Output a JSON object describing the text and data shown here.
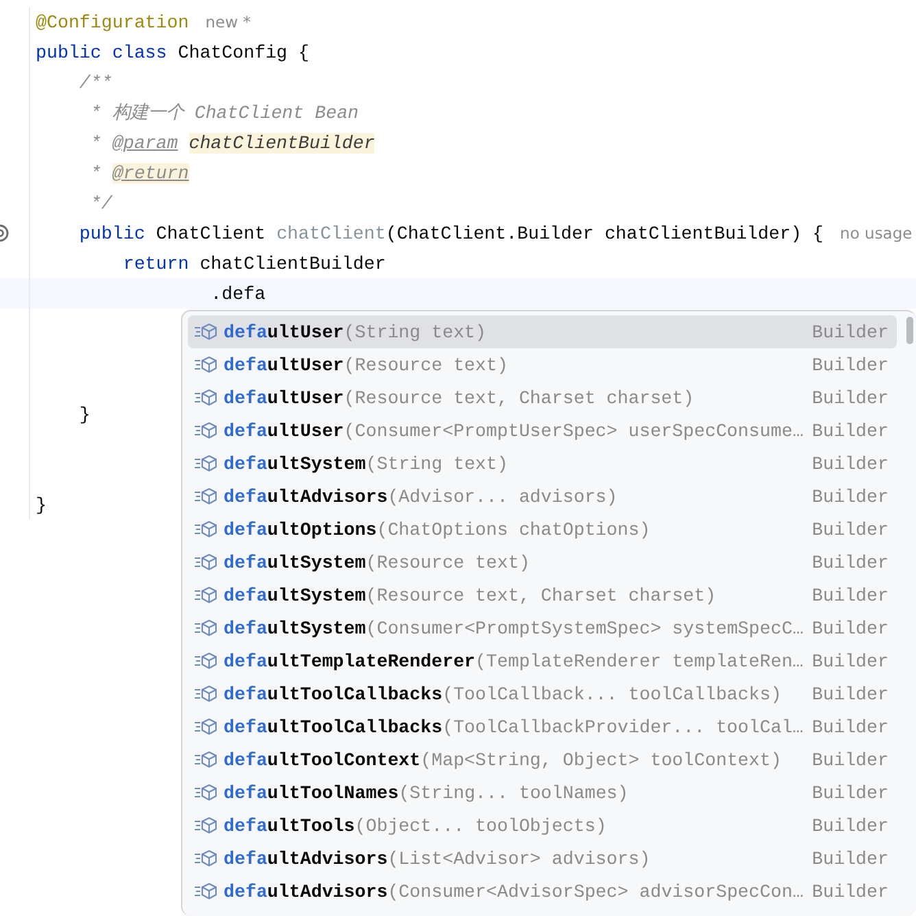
{
  "editor": {
    "lines": [
      {
        "kind": "code",
        "tokens": [
          {
            "text": "@Configuration",
            "kind": "annotation"
          }
        ],
        "hint": "new *"
      },
      {
        "kind": "code",
        "tokens": [
          {
            "text": "public class ",
            "kind": "keyword"
          },
          {
            "text": "ChatConfig {",
            "kind": "plain"
          }
        ]
      },
      {
        "kind": "code",
        "tokens": [
          {
            "text": "    /**",
            "kind": "comment"
          }
        ]
      },
      {
        "kind": "code",
        "tokens": [
          {
            "text": "     * 构建一个 ChatClient Bean",
            "kind": "comment"
          }
        ]
      },
      {
        "kind": "code",
        "tokens": [
          {
            "text": "     * ",
            "kind": "comment"
          },
          {
            "text": "@param",
            "kind": "doc-tag"
          },
          {
            "text": "chatClientBuilder",
            "kind": "doc-param"
          }
        ]
      },
      {
        "kind": "code",
        "tokens": [
          {
            "text": "     * ",
            "kind": "comment"
          },
          {
            "text": "@return",
            "kind": "doc-tag-marked"
          }
        ]
      },
      {
        "kind": "code",
        "tokens": [
          {
            "text": "     */",
            "kind": "comment"
          }
        ]
      },
      {
        "kind": "code",
        "tokens": [
          {
            "text": "    public ",
            "kind": "keyword"
          },
          {
            "text": "ChatClient ",
            "kind": "plain"
          },
          {
            "text": "chatClient",
            "kind": "unused"
          },
          {
            "text": "(ChatClient.Builder chatClientBuilder) {",
            "kind": "plain"
          }
        ],
        "hint": "no usage",
        "marked": true
      },
      {
        "kind": "code",
        "tokens": [
          {
            "text": "        return ",
            "kind": "keyword"
          },
          {
            "text": "chatClientBuilder",
            "kind": "plain"
          }
        ]
      },
      {
        "kind": "code",
        "tokens": [
          {
            "text": "                .defa",
            "kind": "plain"
          }
        ],
        "current": true
      },
      {
        "kind": "blank"
      },
      {
        "kind": "blank"
      },
      {
        "kind": "blank"
      },
      {
        "kind": "code",
        "tokens": [
          {
            "text": "    }",
            "kind": "plain"
          }
        ]
      },
      {
        "kind": "blank"
      },
      {
        "kind": "blank"
      },
      {
        "kind": "code",
        "tokens": [
          {
            "text": "}",
            "kind": "plain"
          }
        ]
      }
    ]
  },
  "completion": {
    "items": [
      {
        "match": "defa",
        "name_rest": "ultUser",
        "params": "(String text)",
        "type": "Builder",
        "selected": true
      },
      {
        "match": "defa",
        "name_rest": "ultUser",
        "params": "(Resource text)",
        "type": "Builder",
        "selected": false
      },
      {
        "match": "defa",
        "name_rest": "ultUser",
        "params": "(Resource text, Charset charset)",
        "type": "Builder",
        "selected": false
      },
      {
        "match": "defa",
        "name_rest": "ultUser",
        "params": "(Consumer<PromptUserSpec> userSpecConsume…",
        "type": "Builder",
        "selected": false
      },
      {
        "match": "defa",
        "name_rest": "ultSystem",
        "params": "(String text)",
        "type": "Builder",
        "selected": false
      },
      {
        "match": "defa",
        "name_rest": "ultAdvisors",
        "params": "(Advisor... advisors)",
        "type": "Builder",
        "selected": false
      },
      {
        "match": "defa",
        "name_rest": "ultOptions",
        "params": "(ChatOptions chatOptions)",
        "type": "Builder",
        "selected": false
      },
      {
        "match": "defa",
        "name_rest": "ultSystem",
        "params": "(Resource text)",
        "type": "Builder",
        "selected": false
      },
      {
        "match": "defa",
        "name_rest": "ultSystem",
        "params": "(Resource text, Charset charset)",
        "type": "Builder",
        "selected": false
      },
      {
        "match": "defa",
        "name_rest": "ultSystem",
        "params": "(Consumer<PromptSystemSpec> systemSpecC…",
        "type": "Builder",
        "selected": false
      },
      {
        "match": "defa",
        "name_rest": "ultTemplateRenderer",
        "params": "(TemplateRenderer templateRen…",
        "type": "Builder",
        "selected": false
      },
      {
        "match": "defa",
        "name_rest": "ultToolCallbacks",
        "params": "(ToolCallback... toolCallbacks)",
        "type": "Builder",
        "selected": false
      },
      {
        "match": "defa",
        "name_rest": "ultToolCallbacks",
        "params": "(ToolCallbackProvider... toolCal…",
        "type": "Builder",
        "selected": false
      },
      {
        "match": "defa",
        "name_rest": "ultToolContext",
        "params": "(Map<String, Object> toolContext)",
        "type": "Builder",
        "selected": false
      },
      {
        "match": "defa",
        "name_rest": "ultToolNames",
        "params": "(String... toolNames)",
        "type": "Builder",
        "selected": false
      },
      {
        "match": "defa",
        "name_rest": "ultTools",
        "params": "(Object... toolObjects)",
        "type": "Builder",
        "selected": false
      },
      {
        "match": "defa",
        "name_rest": "ultAdvisors",
        "params": "(List<Advisor> advisors)",
        "type": "Builder",
        "selected": false
      },
      {
        "match": "defa",
        "name_rest": "ultAdvisors",
        "params": "(Consumer<AdvisorSpec> advisorSpecCon…",
        "type": "Builder",
        "selected": false
      }
    ]
  }
}
